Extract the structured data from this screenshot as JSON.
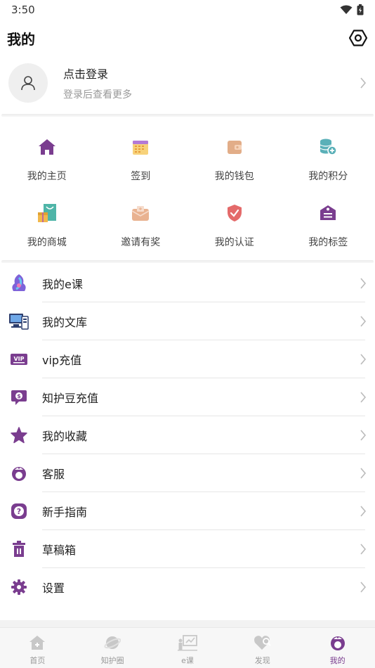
{
  "status": {
    "time": "3:50"
  },
  "header": {
    "title": "我的"
  },
  "login": {
    "title": "点击登录",
    "subtitle": "登录后查看更多"
  },
  "grid": {
    "items": [
      {
        "label": "我的主页",
        "icon": "home-icon"
      },
      {
        "label": "签到",
        "icon": "calendar-icon"
      },
      {
        "label": "我的钱包",
        "icon": "wallet-icon"
      },
      {
        "label": "我的积分",
        "icon": "coins-icon"
      },
      {
        "label": "我的商城",
        "icon": "shop-bag-icon"
      },
      {
        "label": "邀请有奖",
        "icon": "gift-envelope-icon"
      },
      {
        "label": "我的认证",
        "icon": "shield-check-icon"
      },
      {
        "label": "我的标签",
        "icon": "tag-icon"
      }
    ]
  },
  "menu": {
    "items": [
      {
        "label": "我的e课",
        "icon": "ecourse-icon"
      },
      {
        "label": "我的文库",
        "icon": "library-computer-icon"
      },
      {
        "label": "vip充值",
        "icon": "vip-icon"
      },
      {
        "label": "知护豆充值",
        "icon": "coin-chat-icon"
      },
      {
        "label": "我的收藏",
        "icon": "star-icon"
      },
      {
        "label": "客服",
        "icon": "nurse-icon"
      },
      {
        "label": "新手指南",
        "icon": "question-icon"
      },
      {
        "label": "草稿箱",
        "icon": "trash-icon"
      },
      {
        "label": "设置",
        "icon": "gear-icon"
      }
    ]
  },
  "tabs": {
    "items": [
      {
        "label": "首页",
        "icon": "home-tab-icon",
        "active": false
      },
      {
        "label": "知护圈",
        "icon": "planet-icon",
        "active": false
      },
      {
        "label": "e课",
        "icon": "lecture-icon",
        "active": false
      },
      {
        "label": "发现",
        "icon": "discover-icon",
        "active": false
      },
      {
        "label": "我的",
        "icon": "profile-nurse-icon",
        "active": true
      }
    ]
  },
  "colors": {
    "accent": "#7a3d8f",
    "muted": "#999999"
  }
}
